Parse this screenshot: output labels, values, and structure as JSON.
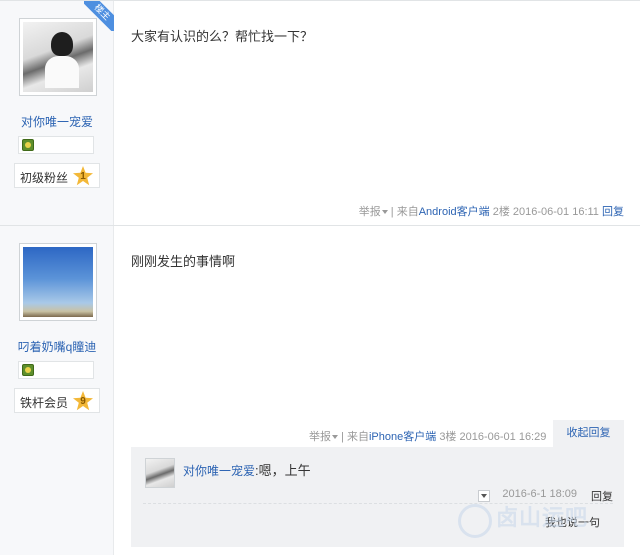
{
  "posts": [
    {
      "badge": "楼主",
      "username": "对你唯一宠爱",
      "level_name": "初级粉丝",
      "level_num": "1",
      "content": "大家有认识的么？帮忙找一下？",
      "report": "举报",
      "sep": "|",
      "source_prefix": "来自",
      "source": "Android客户端",
      "floor": "2楼",
      "time": "2016-06-01 16:11",
      "reply": "回复"
    },
    {
      "username": "叼着奶嘴q瞳迪",
      "level_name": "铁杆会员",
      "level_num": "9",
      "content": "刚刚发生的事情啊",
      "report": "举报",
      "sep": "|",
      "source_prefix": "来自",
      "source": "iPhone客户端",
      "floor": "3楼",
      "time": "2016-06-01 16:29",
      "collapse": "收起回复",
      "sub_replies": [
        {
          "user": "对你唯一宠爱",
          "message": ":嗯，上午",
          "time": "2016-6-1 18:09",
          "reply": "回复"
        }
      ],
      "reply_input_label": "我也说一句"
    }
  ],
  "watermark": {
    "text": "卤山运吧",
    "sub": "鹿山运吧采集"
  }
}
